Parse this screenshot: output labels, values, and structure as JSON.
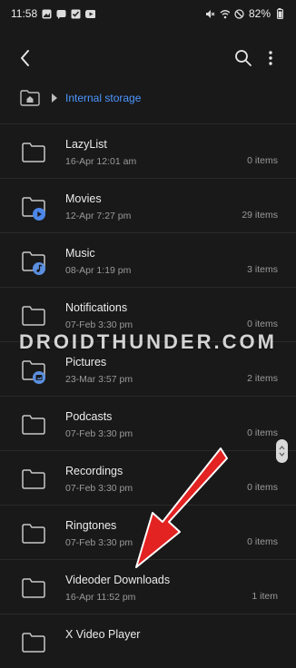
{
  "status": {
    "time": "11:58",
    "battery": "82%",
    "left_icons": [
      "gallery-icon",
      "message-icon",
      "check-icon",
      "youtube-icon"
    ],
    "right_icons": [
      "mute-icon",
      "wifi-icon",
      "dnd-icon"
    ]
  },
  "appbar": {
    "back_icon": "back-chevron-icon",
    "search_icon": "search-icon",
    "more_icon": "more-vertical-icon"
  },
  "breadcrumb": {
    "home_icon": "home-icon",
    "label": "Internal storage"
  },
  "folders": [
    {
      "name": "LazyList",
      "date": "16-Apr 12:01 am",
      "count": "0 items",
      "badge": null
    },
    {
      "name": "Movies",
      "date": "12-Apr 7:27 pm",
      "count": "29 items",
      "badge": "play-badge-icon"
    },
    {
      "name": "Music",
      "date": "08-Apr 1:19 pm",
      "count": "3 items",
      "badge": "music-badge-icon"
    },
    {
      "name": "Notifications",
      "date": "07-Feb 3:30 pm",
      "count": "0 items",
      "badge": null
    },
    {
      "name": "Pictures",
      "date": "23-Mar 3:57 pm",
      "count": "2 items",
      "badge": "image-badge-icon"
    },
    {
      "name": "Podcasts",
      "date": "07-Feb 3:30 pm",
      "count": "0 items",
      "badge": null
    },
    {
      "name": "Recordings",
      "date": "07-Feb 3:30 pm",
      "count": "0 items",
      "badge": null
    },
    {
      "name": "Ringtones",
      "date": "07-Feb 3:30 pm",
      "count": "0 items",
      "badge": null
    },
    {
      "name": "Videoder Downloads",
      "date": "16-Apr 11:52 pm",
      "count": "1 item",
      "badge": null
    },
    {
      "name": "X Video Player",
      "date": "",
      "count": "",
      "badge": null
    }
  ],
  "watermark": "DROIDTHUNDER.COM",
  "colors": {
    "accent": "#4c96ff",
    "arrow": "#e32222",
    "background": "#191919"
  }
}
